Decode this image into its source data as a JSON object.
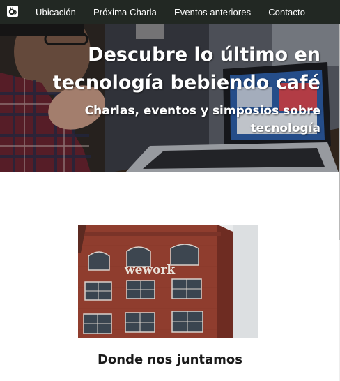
{
  "nav": {
    "logo_icon": "coffee-cup-logo-icon",
    "items": [
      "Ubicación",
      "Próxima Charla",
      "Eventos anteriores",
      "Contacto"
    ]
  },
  "hero": {
    "title": "Descubre lo último en tecnología bebiendo café",
    "subtitle": "Charlas, eventos y simposios sobre tecnología"
  },
  "location": {
    "sign_text": "wework",
    "heading": "Donde nos juntamos"
  },
  "colors": {
    "navbar": "#222823",
    "nav_text": "#ffffff",
    "brick": "#8b3a2c",
    "heading_text": "#1a1a1a"
  }
}
